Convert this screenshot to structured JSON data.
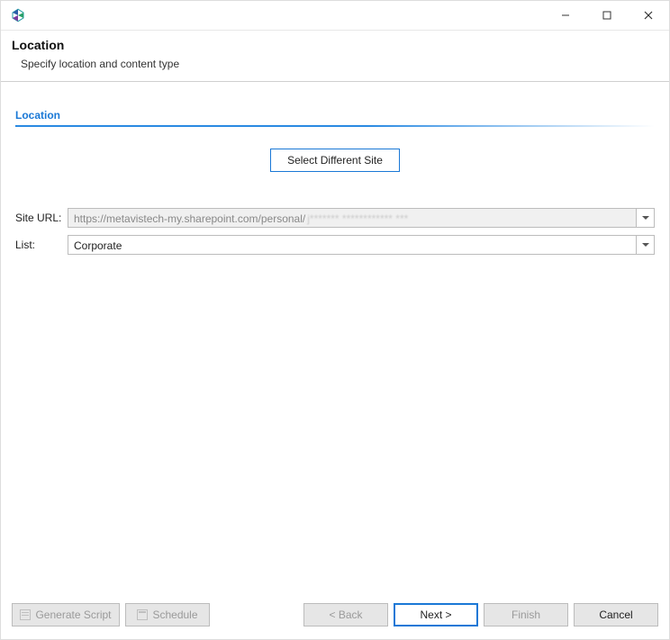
{
  "header": {
    "title": "Location",
    "subtitle": "Specify location and content type"
  },
  "section": {
    "label": "Location"
  },
  "buttons": {
    "select_site": "Select Different Site"
  },
  "form": {
    "site_url_label": "Site URL:",
    "site_url_value": "https://metavistech-my.sharepoint.com/personal/",
    "site_url_obscured": "j******* ************ ***",
    "list_label": "List:",
    "list_value": "Corporate"
  },
  "footer": {
    "generate_script": "Generate Script",
    "schedule": "Schedule",
    "back": "< Back",
    "next": "Next >",
    "finish": "Finish",
    "cancel": "Cancel"
  }
}
